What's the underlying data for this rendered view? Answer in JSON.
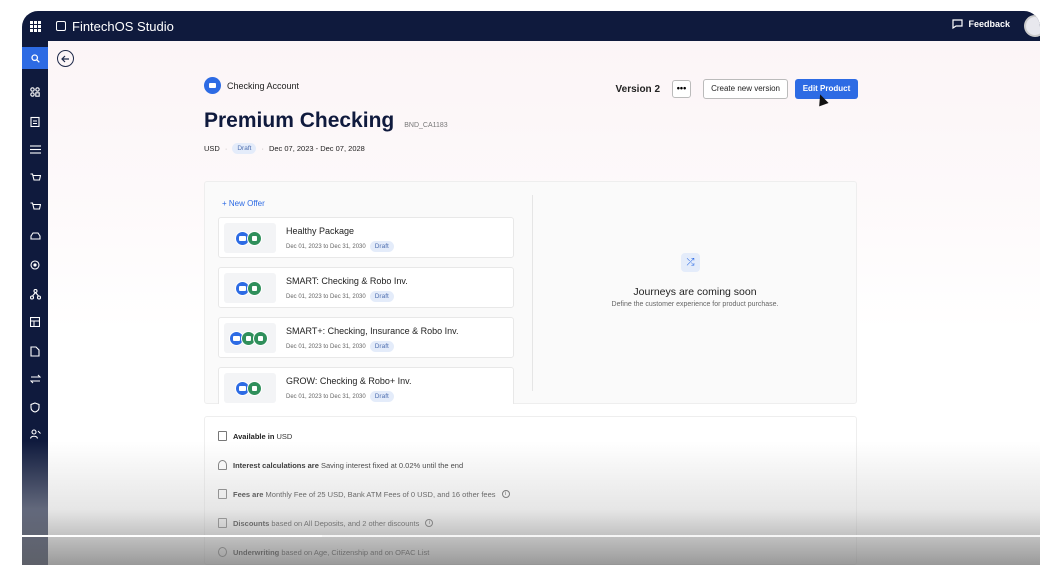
{
  "app": {
    "title": "FintechOS Studio",
    "feedback_label": "Feedback"
  },
  "sidenav": {
    "items": [
      "search-icon",
      "dashboard-icon",
      "clipboard-icon",
      "list-icon",
      "cart-icon",
      "cart-icon-2",
      "car-icon",
      "target-icon",
      "network-icon",
      "table-icon",
      "document-icon",
      "transfer-icon",
      "shield-icon",
      "user-icon"
    ]
  },
  "header": {
    "product_type": "Checking Account",
    "version": "Version 2",
    "more_label": "•••",
    "create_version_label": "Create new version",
    "edit_product_label": "Edit Product",
    "title": "Premium Checking",
    "code": "BND_CA1183",
    "currency": "USD",
    "status": "Draft",
    "date_range": "Dec 07, 2023 - Dec 07, 2028"
  },
  "offers": {
    "new_offer_label": "+ New Offer",
    "items": [
      {
        "name": "Healthy Package",
        "dates": "Dec 01, 2023 to Dec 31, 2030",
        "status": "Draft"
      },
      {
        "name": "SMART: Checking & Robo Inv.",
        "dates": "Dec 01, 2023 to Dec 31, 2030",
        "status": "Draft"
      },
      {
        "name": "SMART+: Checking, Insurance & Robo Inv.",
        "dates": "Dec 01, 2023 to Dec 31, 2030",
        "status": "Draft"
      },
      {
        "name": "GROW: Checking & Robo+ Inv.",
        "dates": "Dec 01, 2023 to Dec 31, 2030",
        "status": "Draft"
      }
    ]
  },
  "journeys": {
    "title": "Journeys are coming soon",
    "subtitle": "Define the customer experience for product purchase."
  },
  "summary": {
    "available_bold": "Available in",
    "available_text": "USD",
    "interest_bold": "Interest calculations are",
    "interest_text": "Saving interest fixed at 0.02% until the end",
    "fees_bold": "Fees are",
    "fees_text": "Monthly Fee of 25 USD, Bank ATM Fees of 0 USD, and 16 other fees",
    "discounts_bold": "Discounts",
    "discounts_text": "based on All Deposits, and 2 other discounts",
    "underwriting_bold": "Underwriting",
    "underwriting_text": "based on Age, Citizenship and on OFAC List"
  },
  "colors": {
    "nav_bg": "#0f1a3d",
    "accent": "#2d6be4"
  }
}
